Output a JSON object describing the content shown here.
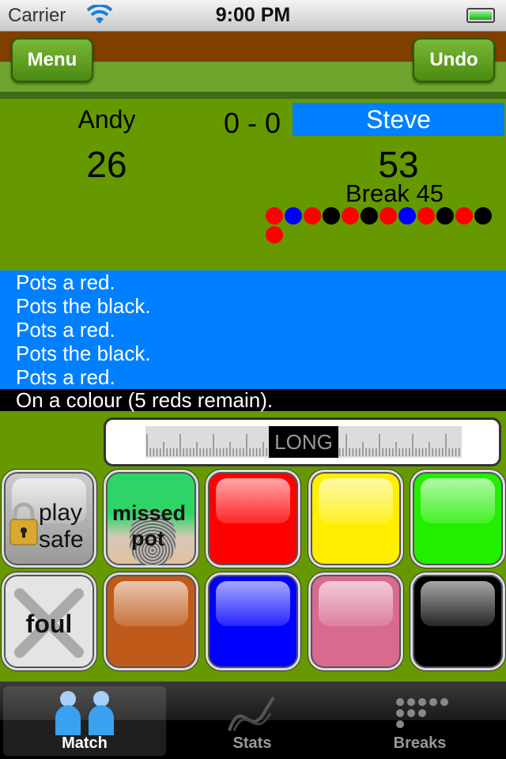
{
  "status_bar": {
    "carrier": "Carrier",
    "time": "9:00 PM",
    "battery_icon": "battery-full-icon",
    "wifi_icon": "wifi-icon"
  },
  "header": {
    "menu_label": "Menu",
    "undo_label": "Undo"
  },
  "scoreboard": {
    "player1": {
      "name": "Andy",
      "score": "26"
    },
    "frames": "0 - 0",
    "player2": {
      "name": "Steve",
      "score": "53",
      "active": true
    },
    "break_label": "Break 45",
    "break_balls": [
      "red",
      "blue",
      "red",
      "black",
      "red",
      "black",
      "red",
      "blue",
      "red",
      "black",
      "red",
      "black",
      "red"
    ]
  },
  "log": {
    "lines": [
      "Pots a red.",
      "Pots the black.",
      "Pots a red.",
      "Pots the black.",
      "Pots a red."
    ],
    "current": "On a colour (5 reds remain)."
  },
  "shot_length": {
    "selected": "LONG"
  },
  "buttons": {
    "play_safe": [
      "play",
      "safe"
    ],
    "missed_pot": [
      "missed",
      "pot"
    ],
    "foul": "foul"
  },
  "ball_colors": {
    "red": "#ff0000",
    "yellow": "#ffee00",
    "green": "#22ee00",
    "brown": "#c05a1a",
    "blue": "#0000ff",
    "pink": "#d86a8e",
    "black": "#000000"
  },
  "colors": {
    "felt": "#669900",
    "log": "#0080ff",
    "active_player": "#0080ff"
  },
  "tabs": [
    {
      "label": "Match",
      "icon": "players-icon",
      "selected": true
    },
    {
      "label": "Stats",
      "icon": "chart-icon"
    },
    {
      "label": "Breaks",
      "icon": "dots-icon"
    }
  ]
}
